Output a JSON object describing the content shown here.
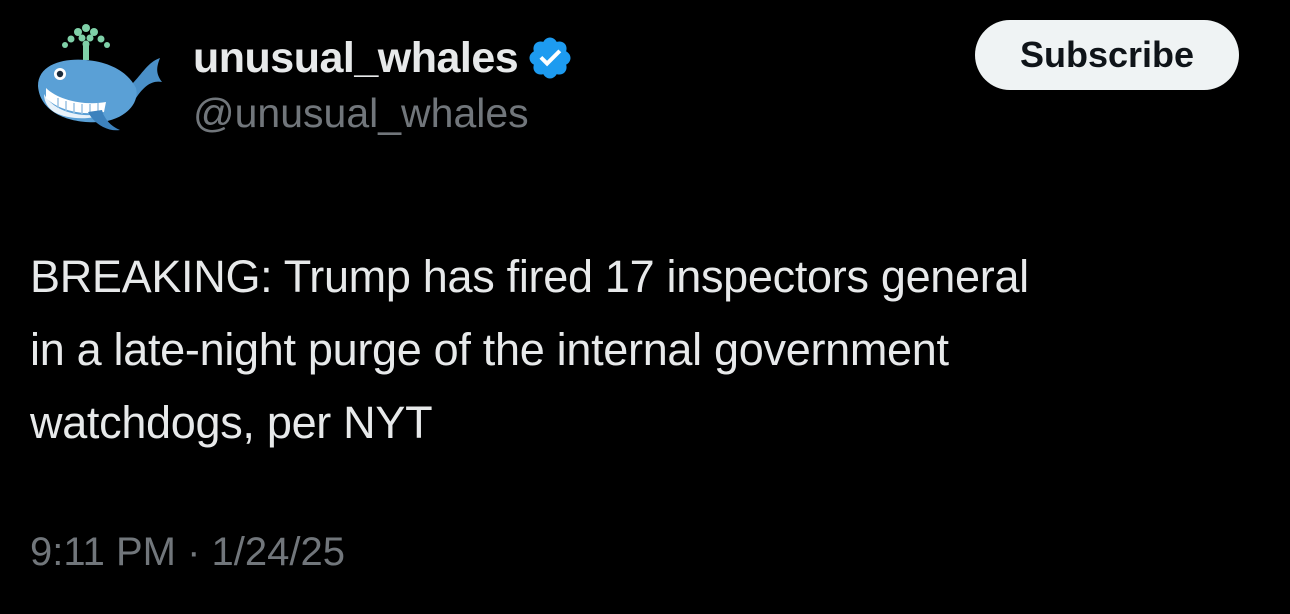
{
  "author": {
    "display_name": "unusual_whales",
    "handle": "@unusual_whales",
    "avatar_icon": "whale-icon",
    "verified_icon": "verified-badge-icon",
    "verified_color": "#1d9bf0"
  },
  "actions": {
    "subscribe_label": "Subscribe"
  },
  "tweet": {
    "text": "BREAKING: Trump has fired 17 inspectors general\nin a late-night purge of the internal government\nwatchdogs, per NYT",
    "timestamp": "9:11 PM · 1/24/25"
  },
  "colors": {
    "background": "#000000",
    "primary_text": "#e7e9ea",
    "secondary_text": "#71767b",
    "button_bg": "#eff3f4",
    "button_text": "#0f1419"
  }
}
